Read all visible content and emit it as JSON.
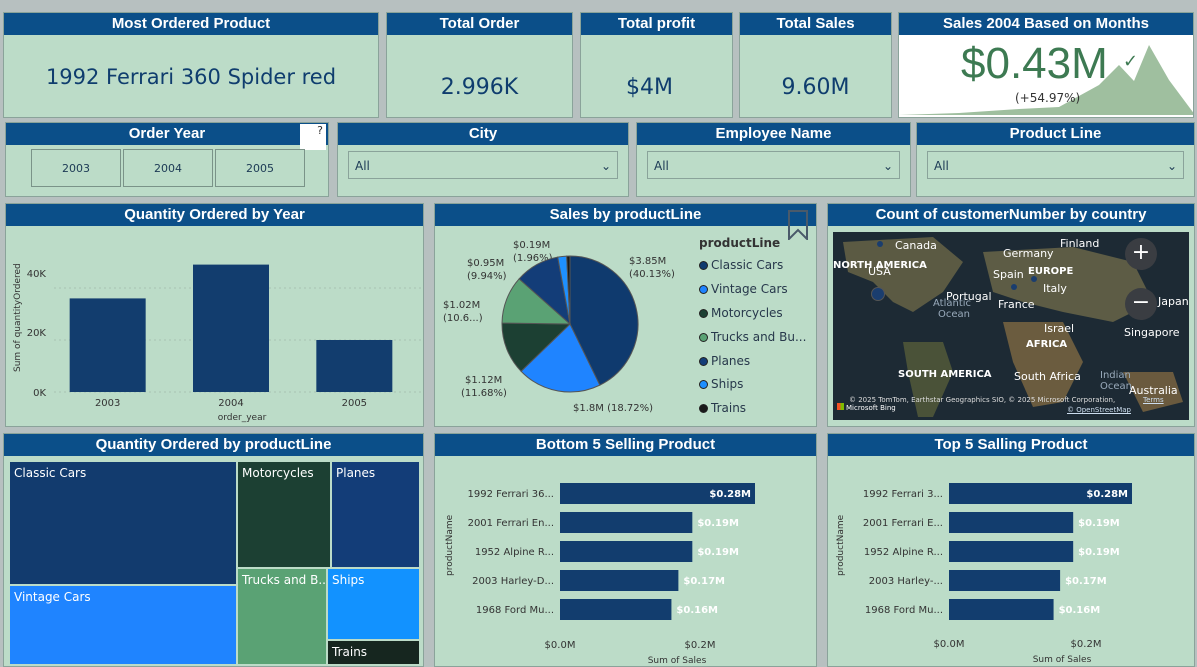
{
  "kpis": {
    "most_ordered": {
      "title": "Most Ordered Product",
      "value": "1992 Ferrari 360 Spider red"
    },
    "total_order": {
      "title": "Total Order",
      "value": "2.996K"
    },
    "total_profit": {
      "title": "Total profit",
      "value": "$4M"
    },
    "total_sales": {
      "title": "Total Sales",
      "value": "9.60M"
    },
    "sales_2004": {
      "title": "Sales 2004 Based on Months",
      "value": "$0.43M",
      "change": "(+54.97%)",
      "check": "✓"
    }
  },
  "slicers": {
    "order_year": {
      "title": "Order Year",
      "options": [
        "2003",
        "2004",
        "2005"
      ],
      "help": "?"
    },
    "city": {
      "title": "City",
      "value": "All"
    },
    "employee": {
      "title": "Employee Name",
      "value": "All"
    },
    "product_line": {
      "title": "Product Line",
      "value": "All"
    }
  },
  "qty_by_year": {
    "title": "Quantity Ordered by Year",
    "ylabel": "Sum of quantityOrdered",
    "xlabel": "order_year",
    "yticks": [
      "0K",
      "20K",
      "40K"
    ]
  },
  "sales_pie": {
    "title": "Sales by productLine",
    "legend_title": "productLine",
    "labels": [
      {
        "line1": "$3.85M",
        "line2": "(40.13%)"
      },
      {
        "line1": "$1.8M (18.72%)",
        "line2": ""
      },
      {
        "line1": "$1.12M",
        "line2": "(11.68%)"
      },
      {
        "line1": "$1.02M",
        "line2": "(10.6...)"
      },
      {
        "line1": "$0.95M",
        "line2": "(9.94%)"
      },
      {
        "line1": "$0.19M",
        "line2": "(1.96%)"
      }
    ],
    "legend": [
      "Classic Cars",
      "Vintage Cars",
      "Motorcycles",
      "Trucks and Bu...",
      "Planes",
      "Ships",
      "Trains"
    ]
  },
  "map": {
    "title": "Count of customerNumber by country",
    "labels": [
      "Canada",
      "Germany",
      "Finland",
      "NORTH AMERICA",
      "USA",
      "Spain",
      "EUROPE",
      "Italy",
      "Portugal",
      "France",
      "Atlantic",
      "Ocean",
      "Israel",
      "AFRICA",
      "Japan",
      "Singapore",
      "SOUTH AMERICA",
      "South Africa",
      "Indian",
      "Ocean",
      "Australia"
    ],
    "attribution": "© 2025 TomTom, Earthstar Geographics SIO, © 2025 Microsoft Corporation,",
    "terms": "Terms",
    "osm": "© OpenStreetMap",
    "bing": "Microsoft Bing",
    "zoom_in": "+",
    "zoom_out": "−"
  },
  "treemap": {
    "title": "Quantity Ordered by productLine",
    "cells": [
      "Classic Cars",
      "Vintage Cars",
      "Motorcycles",
      "Planes",
      "Trucks and B...",
      "Ships",
      "Trains"
    ]
  },
  "bottom5": {
    "title": "Bottom 5 Selling Product",
    "ylabel": "productName",
    "xlabel": "Sum of Sales",
    "xticks": [
      "$0.0M",
      "$0.2M"
    ],
    "products": [
      "1992 Ferrari 36...",
      "2001 Ferrari En...",
      "1952 Alpine R...",
      "2003 Harley-D...",
      "1968 Ford Mu..."
    ],
    "values_label": [
      "$0.28M",
      "$0.19M",
      "$0.19M",
      "$0.17M",
      "$0.16M"
    ]
  },
  "top5": {
    "title": "Top 5 Salling Product",
    "ylabel": "productName",
    "xlabel": "Sum of Sales",
    "xticks": [
      "$0.0M",
      "$0.2M"
    ],
    "products": [
      "1992 Ferrari 3...",
      "2001 Ferrari E...",
      "1952 Alpine R...",
      "2003 Harley-...",
      "1968 Ford Mu..."
    ],
    "values_label": [
      "$0.28M",
      "$0.19M",
      "$0.19M",
      "$0.17M",
      "$0.16M"
    ]
  },
  "chart_data": [
    {
      "type": "bar",
      "title": "Quantity Ordered by Year",
      "categories": [
        "2003",
        "2004",
        "2005"
      ],
      "values": [
        36000,
        49000,
        20000
      ],
      "xlabel": "order_year",
      "ylabel": "Sum of quantityOrdered",
      "ylim": [
        0,
        50000
      ]
    },
    {
      "type": "pie",
      "title": "Sales by productLine",
      "categories": [
        "Classic Cars",
        "Vintage Cars",
        "Trucks and Bu...",
        "Motorcycles",
        "Planes",
        "Ships",
        "Trains"
      ],
      "values": [
        3.85,
        1.8,
        1.12,
        1.02,
        0.95,
        0.19,
        0.07
      ],
      "colors": [
        "#0f3a6e",
        "#1f84ff",
        "#1c4033",
        "#5aa274",
        "#133d78",
        "#1e90ff",
        "#1a1a1a"
      ]
    },
    {
      "type": "bar",
      "title": "Bottom 5 Selling Product",
      "categories": [
        "1992 Ferrari 36...",
        "2001 Ferrari En...",
        "1952 Alpine R...",
        "2003 Harley-D...",
        "1968 Ford Mu..."
      ],
      "values": [
        0.28,
        0.19,
        0.19,
        0.17,
        0.16
      ],
      "xlabel": "Sum of Sales",
      "ylabel": "productName"
    },
    {
      "type": "bar",
      "title": "Top 5 Salling Product",
      "categories": [
        "1992 Ferrari 3...",
        "2001 Ferrari E...",
        "1952 Alpine R...",
        "2003 Harley-...",
        "1968 Ford Mu..."
      ],
      "values": [
        0.28,
        0.19,
        0.19,
        0.17,
        0.16
      ],
      "xlabel": "Sum of Sales",
      "ylabel": "productName"
    }
  ],
  "colors": {
    "header": "#0b4f89",
    "panel": "#bcdcc8",
    "bar": "#123d6e",
    "kpi_green": "#3d7a52"
  }
}
